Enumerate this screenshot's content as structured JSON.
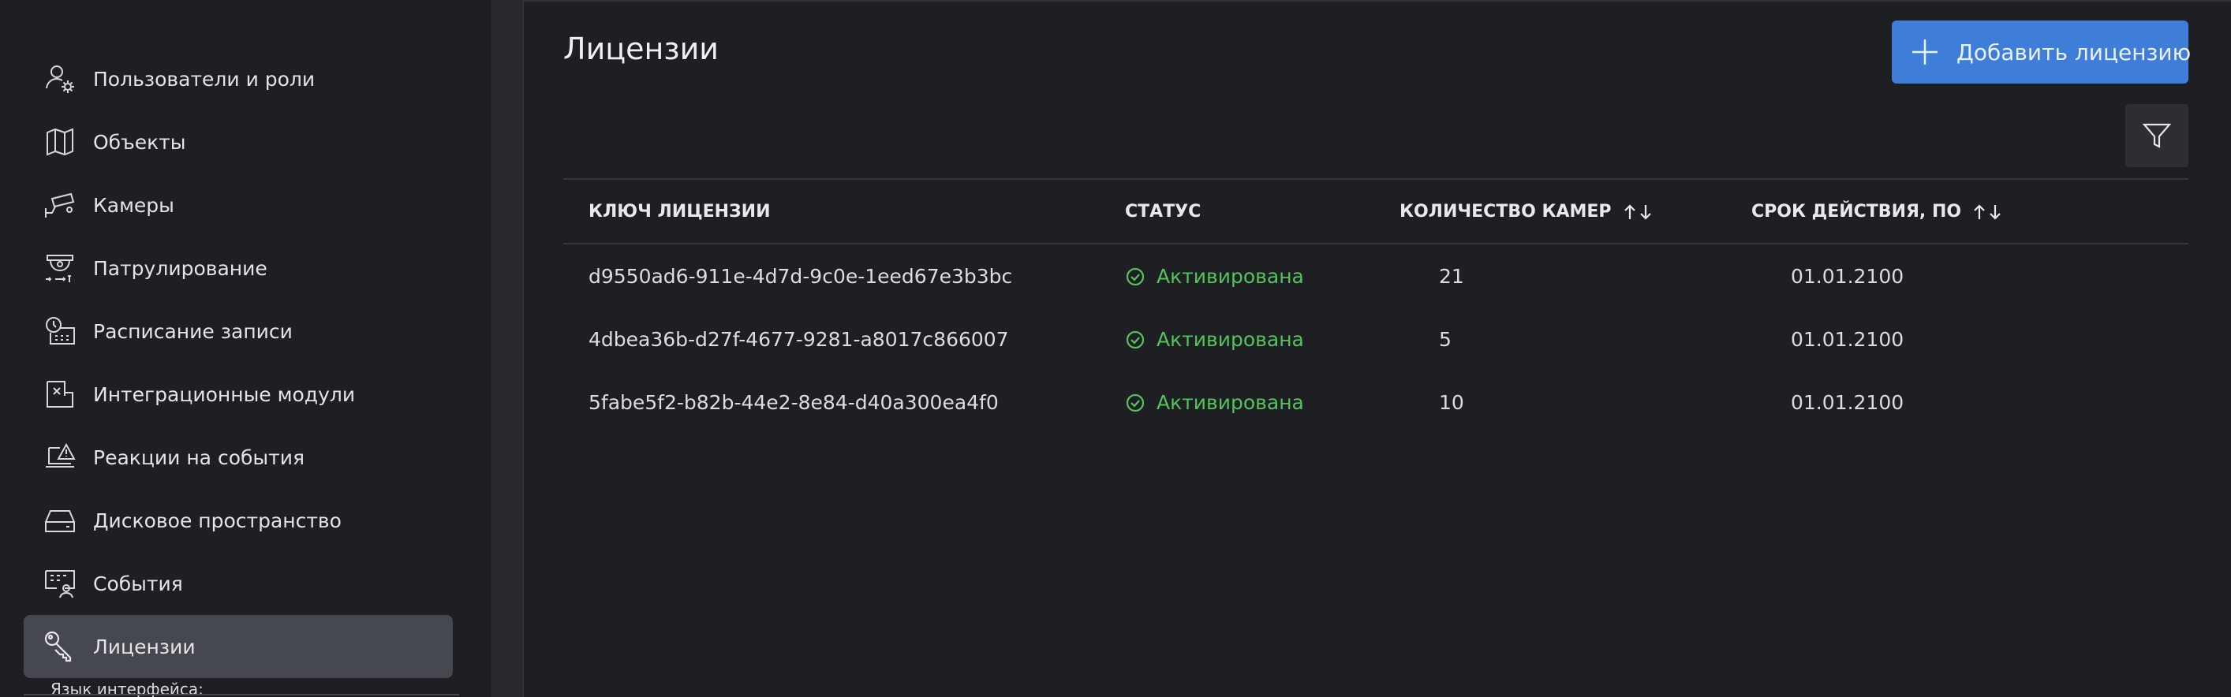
{
  "sidebar": {
    "items": [
      {
        "label": "Пользователи и роли",
        "icon": "users-roles-icon"
      },
      {
        "label": "Объекты",
        "icon": "objects-map-icon"
      },
      {
        "label": "Камеры",
        "icon": "camera-icon"
      },
      {
        "label": "Патрулирование",
        "icon": "patrol-icon"
      },
      {
        "label": "Расписание записи",
        "icon": "schedule-icon"
      },
      {
        "label": "Интеграционные модули",
        "icon": "integration-icon"
      },
      {
        "label": "Реакции на события",
        "icon": "event-reaction-icon"
      },
      {
        "label": "Дисковое пространство",
        "icon": "disk-icon"
      },
      {
        "label": "События",
        "icon": "events-icon"
      },
      {
        "label": "Лицензии",
        "icon": "key-icon"
      }
    ],
    "active_index": 9,
    "language_label": "Язык интерфейса:"
  },
  "main": {
    "title": "Лицензии",
    "add_button_label": "Добавить лицензию",
    "filter_icon": "filter-icon",
    "accent_color": "#3e7dd8",
    "status_color": "#55c25b"
  },
  "table": {
    "headers": [
      "КЛЮЧ ЛИЦЕНЗИИ",
      "СТАТУС",
      "КОЛИЧЕСТВО КАМЕР",
      "СРОК ДЕЙСТВИЯ, ПО"
    ],
    "rows": [
      {
        "key": "d9550ad6-911e-4d7d-9c0e-1eed67e3b3bc",
        "status": "Активирована",
        "cameras": "21",
        "expires": "01.01.2100"
      },
      {
        "key": "4dbea36b-d27f-4677-9281-a8017c866007",
        "status": "Активирована",
        "cameras": "5",
        "expires": "01.01.2100"
      },
      {
        "key": "5fabe5f2-b82b-44e2-8e84-d40a300ea4f0",
        "status": "Активирована",
        "cameras": "10",
        "expires": "01.01.2100"
      }
    ]
  }
}
